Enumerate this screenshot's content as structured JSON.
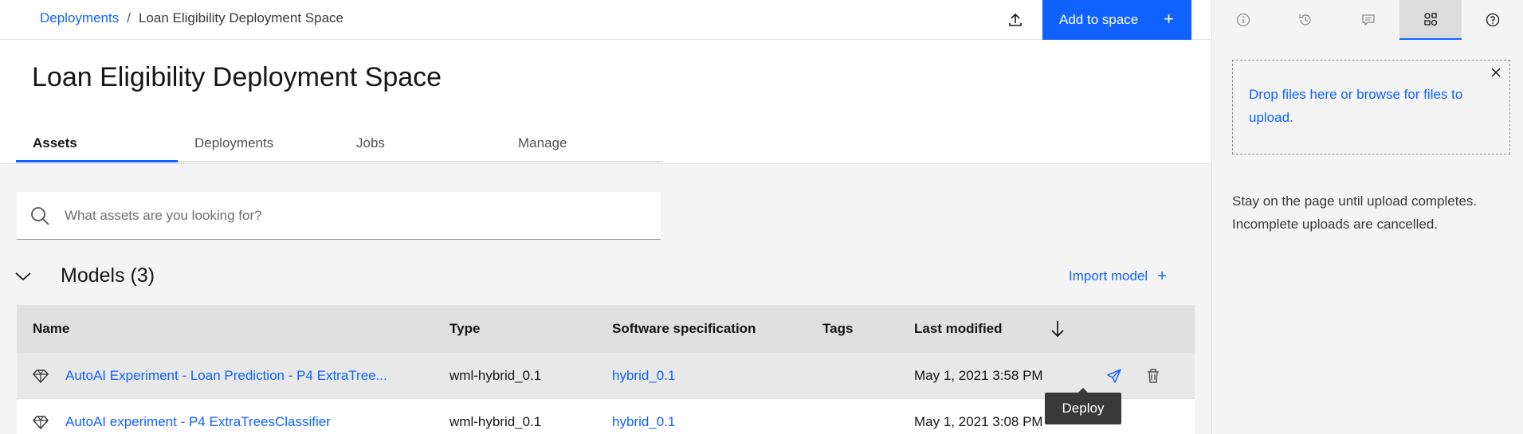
{
  "header": {
    "breadcrumb_root": "Deployments",
    "breadcrumb_separator": "/",
    "breadcrumb_current": "Loan Eligibility Deployment Space",
    "add_button_label": "Add to space",
    "add_button_plus": "+"
  },
  "page": {
    "title": "Loan Eligibility Deployment Space",
    "tabs": [
      {
        "label": "Assets",
        "active": true
      },
      {
        "label": "Deployments",
        "active": false
      },
      {
        "label": "Jobs",
        "active": false
      },
      {
        "label": "Manage",
        "active": false
      }
    ]
  },
  "search": {
    "placeholder": "What assets are you looking for?"
  },
  "models_section": {
    "title": "Models (3)",
    "import_label": "Import model",
    "import_plus": "+"
  },
  "table": {
    "columns": [
      "Name",
      "Type",
      "Software specification",
      "Tags",
      "Last modified"
    ],
    "rows": [
      {
        "name": "AutoAI Experiment - Loan Prediction - P4 ExtraTree...",
        "type": "wml-hybrid_0.1",
        "software": "hybrid_0.1",
        "tags": "",
        "modified": "May 1, 2021 3:58 PM"
      },
      {
        "name": "AutoAI experiment - P4 ExtraTreesClassifier",
        "type": "wml-hybrid_0.1",
        "software": "hybrid_0.1",
        "tags": "",
        "modified": "May 1, 2021 3:08 PM"
      }
    ]
  },
  "tooltip": {
    "label": "Deploy"
  },
  "panel": {
    "dropzone_text": "Drop files here or browse for files to upload.",
    "note": "Stay on the page until upload completes. Incomplete uploads are cancelled."
  },
  "colors": {
    "accent": "#0f62fe",
    "panel_bg": "#f4f4f4",
    "header_row": "#e0e0e0"
  },
  "icons": {
    "header": [
      "upload-icon"
    ],
    "panel_tabs": [
      "info-icon",
      "history-icon",
      "comment-icon",
      "data-assets-icon",
      "help-icon"
    ],
    "row_actions": [
      "deploy-icon",
      "trash-icon"
    ]
  }
}
